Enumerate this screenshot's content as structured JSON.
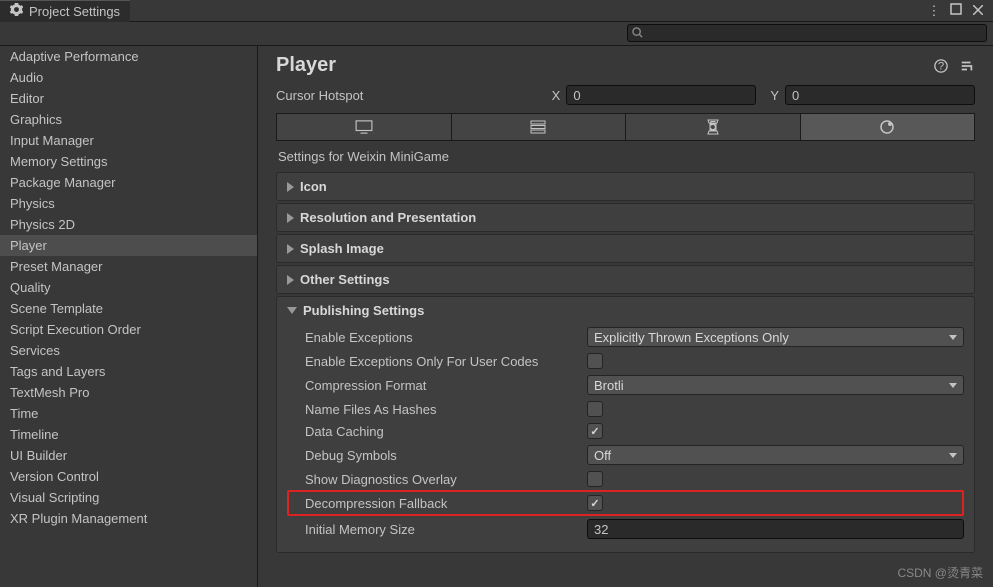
{
  "window": {
    "title": "Project Settings"
  },
  "search": {
    "placeholder": ""
  },
  "sidebar": {
    "items": [
      "Adaptive Performance",
      "Audio",
      "Editor",
      "Graphics",
      "Input Manager",
      "Memory Settings",
      "Package Manager",
      "Physics",
      "Physics 2D",
      "Player",
      "Preset Manager",
      "Quality",
      "Scene Template",
      "Script Execution Order",
      "Services",
      "Tags and Layers",
      "TextMesh Pro",
      "Time",
      "Timeline",
      "UI Builder",
      "Version Control",
      "Visual Scripting",
      "XR Plugin Management"
    ],
    "selected_index": 9
  },
  "content": {
    "title": "Player",
    "cursor_hotspot": {
      "label": "Cursor Hotspot",
      "x_label": "X",
      "x_value": "0",
      "y_label": "Y",
      "y_value": "0"
    },
    "platform_section_label": "Settings for Weixin MiniGame",
    "foldouts": [
      "Icon",
      "Resolution and Presentation",
      "Splash Image",
      "Other Settings"
    ],
    "publishing": {
      "title": "Publishing Settings",
      "enable_exceptions": {
        "label": "Enable Exceptions",
        "value": "Explicitly Thrown Exceptions Only"
      },
      "enable_exceptions_user": {
        "label": "Enable Exceptions Only For User Codes",
        "checked": false
      },
      "compression_format": {
        "label": "Compression Format",
        "value": "Brotli"
      },
      "name_files_as_hashes": {
        "label": "Name Files As Hashes",
        "checked": false
      },
      "data_caching": {
        "label": "Data Caching",
        "checked": true
      },
      "debug_symbols": {
        "label": "Debug Symbols",
        "value": "Off"
      },
      "show_diagnostics": {
        "label": "Show Diagnostics Overlay",
        "checked": false
      },
      "decompression_fallback": {
        "label": "Decompression Fallback",
        "checked": true
      },
      "initial_memory": {
        "label": "Initial Memory Size",
        "value": "32"
      }
    }
  },
  "watermark": "CSDN @烫青菜"
}
